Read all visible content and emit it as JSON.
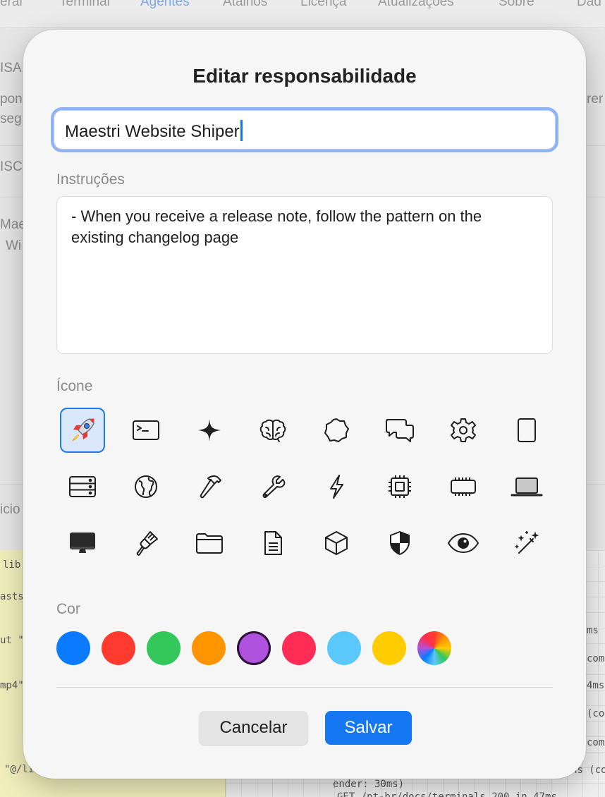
{
  "background": {
    "tabs": [
      "eral",
      "Terminal",
      "Agentes",
      "Atalhos",
      "Licença",
      "Atualizações",
      "Sobre",
      "Dad"
    ],
    "active_tab_index": 2,
    "side_fragments": [
      "ISA",
      "pon",
      "seg",
      "ISC",
      "Mae",
      "Wi",
      "icio",
      "rer"
    ],
    "mono_fragments_left": [
      "lib",
      "asts",
      "ut \"",
      "mp4\"",
      "\"@/li"
    ],
    "mono_fragments_right": [
      "ms",
      "com",
      "4ms",
      "(co",
      "com",
      "ns (co",
      "ender: 30ms)",
      "GET /pt-br/docs/terminals 200 in 47ms"
    ]
  },
  "modal": {
    "title": "Editar responsabilidade",
    "name_value": "Maestri Website Shiper",
    "instructions_label": "Instruções",
    "instructions_value": "- When you receive a release note, follow the pattern on the existing changelog page",
    "icon_label": "Ícone",
    "icons": [
      "rocket-icon",
      "terminal-icon",
      "sparkle-icon",
      "brain-icon",
      "badge-icon",
      "chat-bubbles-icon",
      "gear-icon",
      "tablet-icon",
      "server-rack-icon",
      "globe-icon",
      "hammer-icon",
      "wrench-icon",
      "bolt-icon",
      "cpu-icon",
      "memory-chip-icon",
      "laptop-icon",
      "desktop-icon",
      "paintbrush-icon",
      "folder-icon",
      "document-icon",
      "cube-icon",
      "shield-icon",
      "eye-icon",
      "magic-wand-icon"
    ],
    "selected_icon_index": 0,
    "color_label": "Cor",
    "colors": [
      "#0a7aff",
      "#ff3b30",
      "#34c759",
      "#ff9500",
      "#af52de",
      "#ff2d55",
      "#5ac8fa",
      "#ffcc00",
      "rainbow"
    ],
    "selected_color_index": 4,
    "cancel_label": "Cancelar",
    "save_label": "Salvar"
  }
}
